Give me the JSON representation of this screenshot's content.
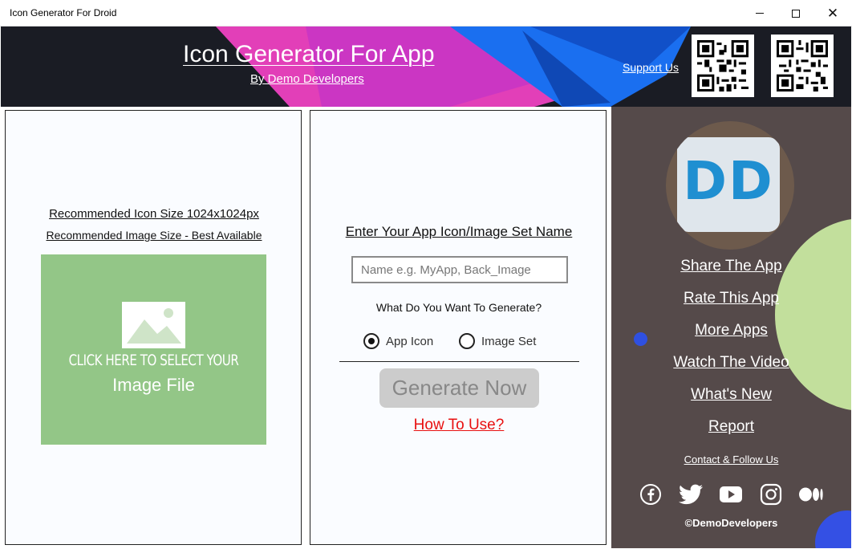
{
  "window": {
    "title": "Icon Generator For Droid",
    "controls": {
      "minimize": "",
      "maximize": "",
      "close": "✕"
    }
  },
  "header": {
    "app_title": "Icon Generator For App",
    "subtitle": "By Demo Developers",
    "support_label": "Support Us",
    "colors": {
      "background": "#1a1c24",
      "magenta": "#e23fb8",
      "blue": "#1a6ff0"
    }
  },
  "left_panel": {
    "recommended_icon": "Recommended Icon Size 1024x1024px",
    "recommended_image": "Recommended Image Size - Best Available",
    "picker_line1": "CLICK HERE TO SELECT YOUR",
    "picker_line2": "Image File",
    "picker_color": "#93c687"
  },
  "middle_panel": {
    "name_label": "Enter Your App Icon/Image Set Name",
    "name_placeholder": "Name e.g. MyApp, Back_Image",
    "name_value": "",
    "question": "What Do You Want To Generate?",
    "options": [
      {
        "label": "App Icon",
        "selected": true
      },
      {
        "label": "Image Set",
        "selected": false
      }
    ],
    "generate_label": "Generate Now",
    "how_to_label": "How To Use?"
  },
  "right_panel": {
    "logo_text": "DD",
    "links": [
      "Share The App",
      "Rate This App",
      "More Apps",
      "Watch The Video",
      "What's New",
      "Report"
    ],
    "contact_label": "Contact & Follow Us",
    "social_icons": [
      "facebook-icon",
      "twitter-icon",
      "youtube-icon",
      "instagram-icon",
      "medium-icon"
    ],
    "copyright": "©DemoDevelopers",
    "background": "#554a4a"
  }
}
